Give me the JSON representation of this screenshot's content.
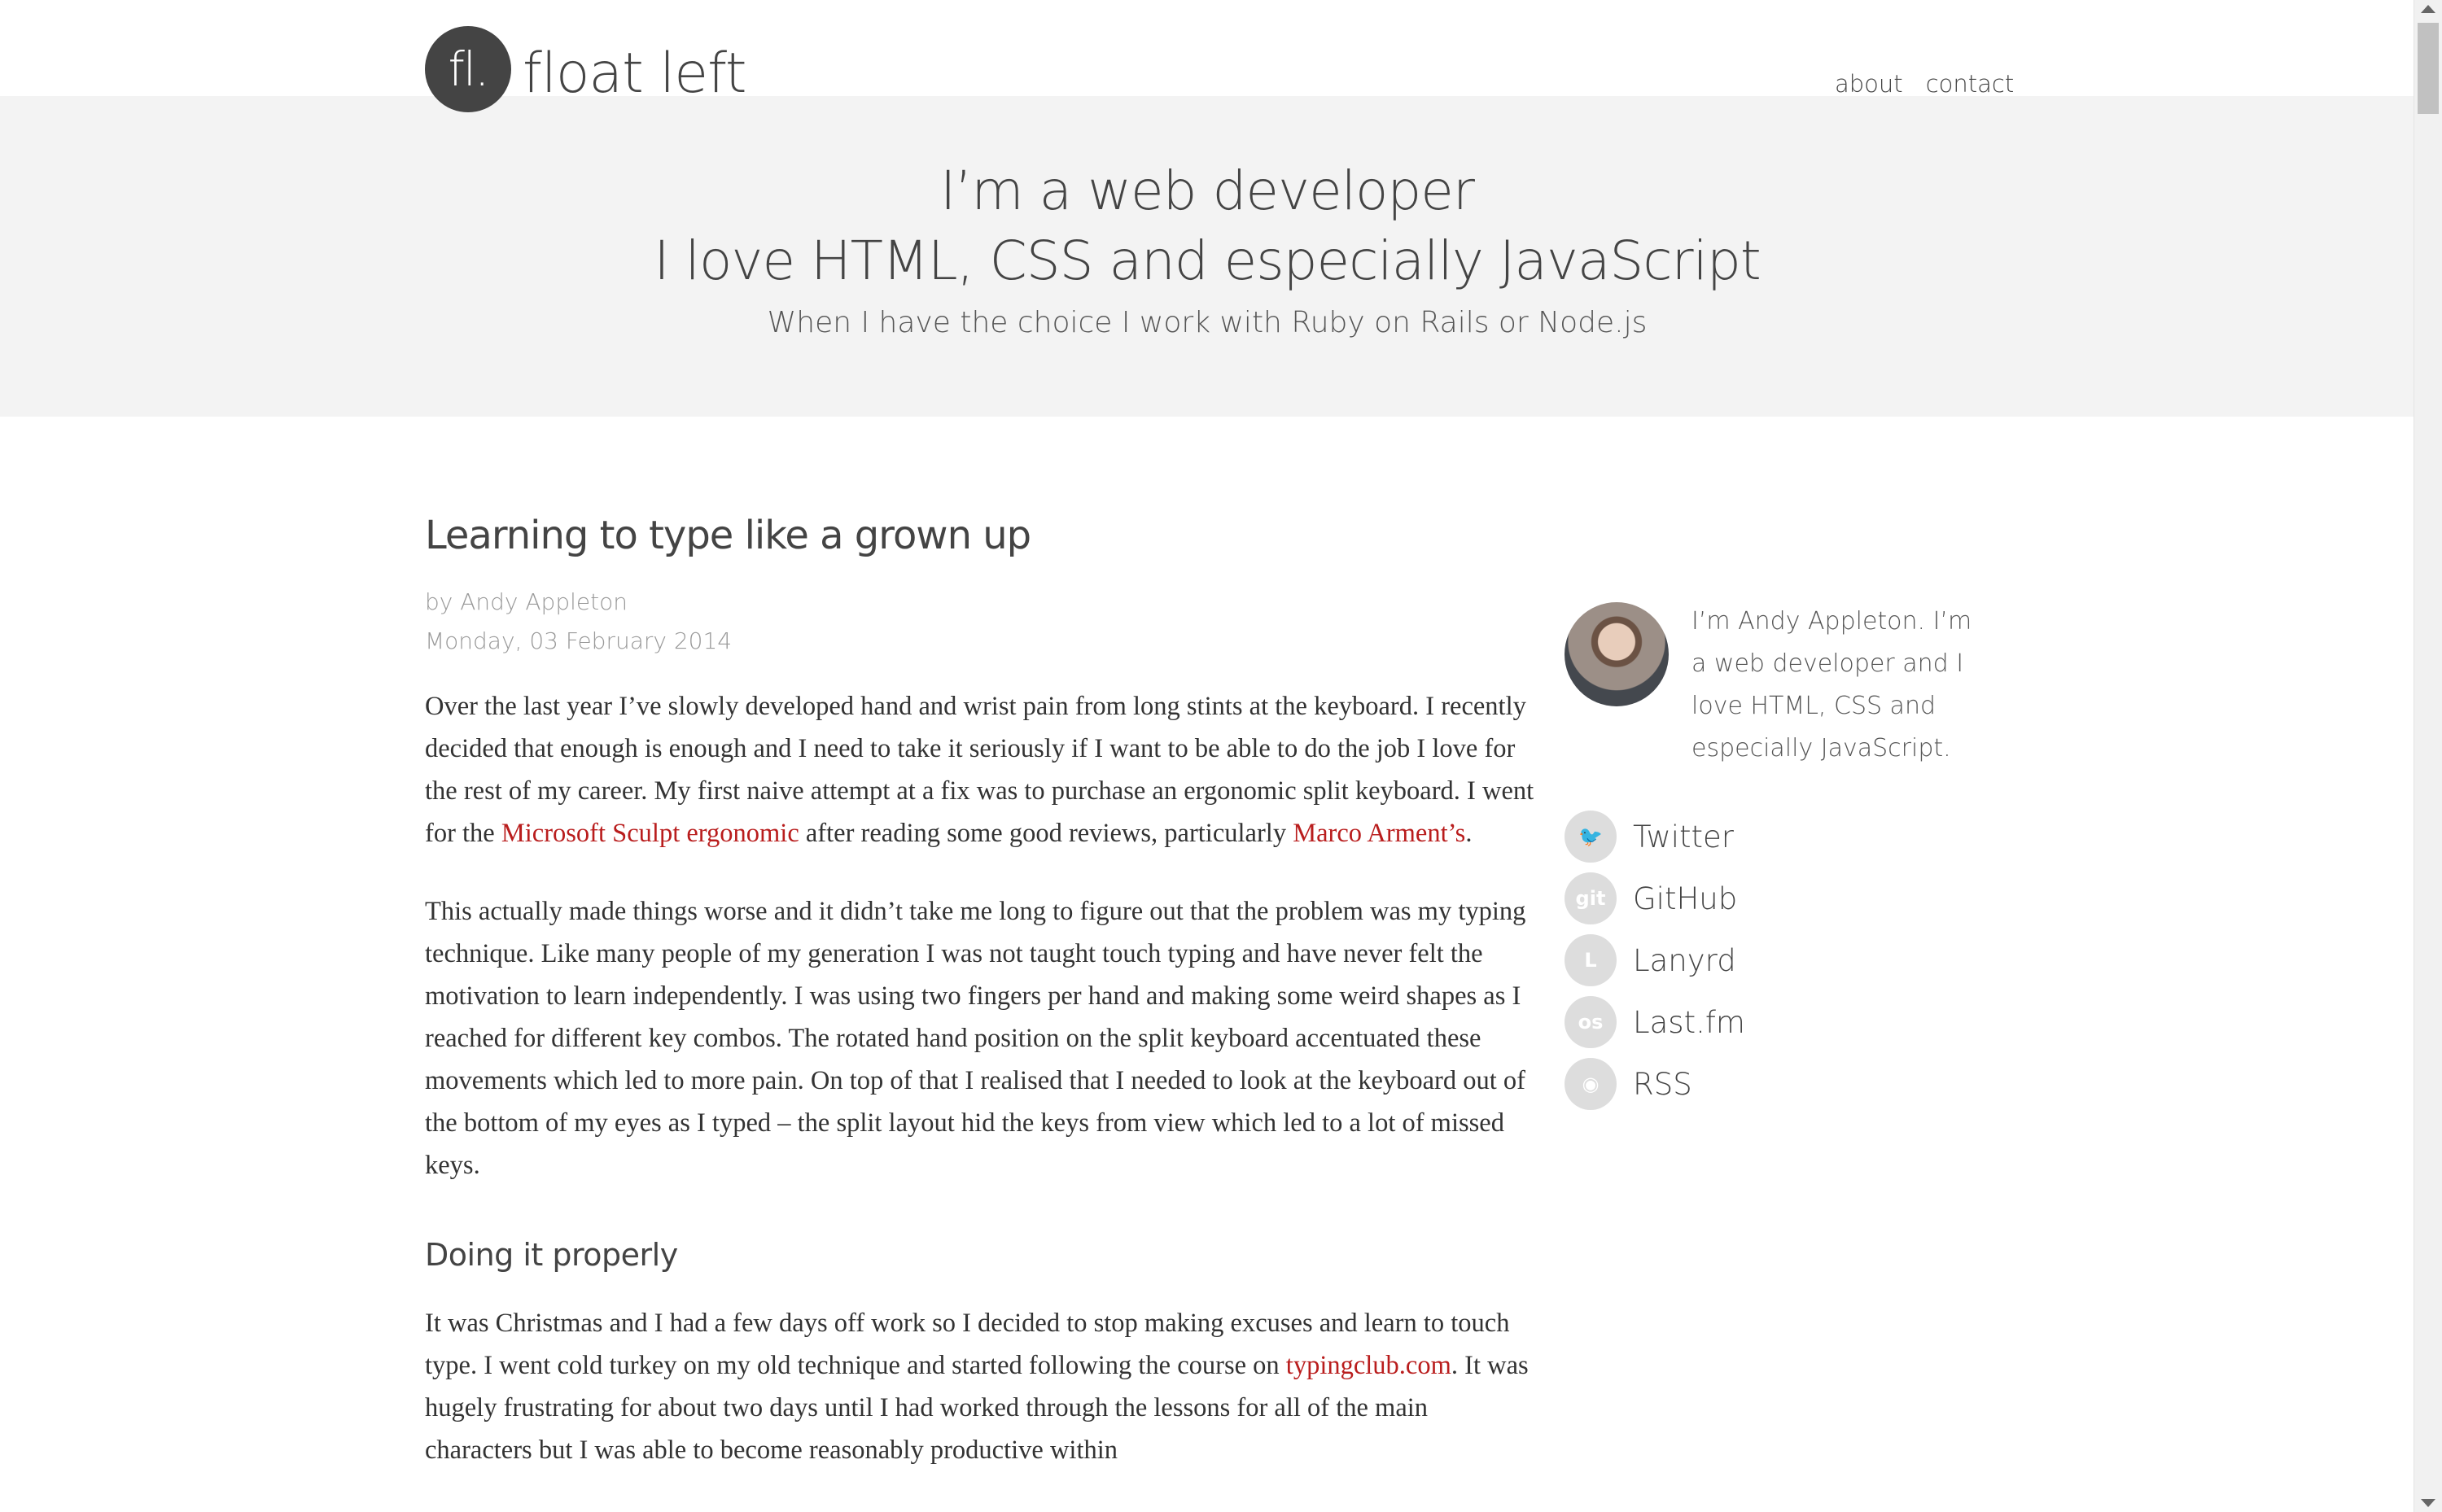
{
  "site": {
    "logo_mark": "fl.",
    "logo_text": "float left",
    "nav": [
      "about",
      "contact"
    ]
  },
  "hero": {
    "line1": "I’m a web developer",
    "line2": "I love HTML, CSS and especially JavaScript",
    "sub": "When I have the choice I work with Ruby on Rails or Node.js"
  },
  "post": {
    "title": "Learning to type like a grown up",
    "author": "by Andy Appleton",
    "date": "Monday, 03 February 2014",
    "p1_a": "Over the last year I’ve slowly developed hand and wrist pain from long stints at the keyboard. I recently decided that enough is enough and I need to take it seriously if I want to be able to do the job I love for the rest of my career. My first naive attempt at a fix was to purchase an ergonomic split keyboard. I went for the ",
    "p1_link1": "Microsoft Sculpt ergonomic",
    "p1_b": " after reading some good reviews, particularly ",
    "p1_link2": "Marco Arment’s",
    "p1_c": ".",
    "p2": "This actually made things worse and it didn’t take me long to figure out that the problem was my typing technique. Like many people of my generation I was not taught touch typing and have never felt the motivation to learn independently. I was using two fingers per hand and making some weird shapes as I reached for different key combos. The rotated hand position on the split keyboard accentuated these movements which led to more pain. On top of that I realised that I needed to look at the keyboard out of the bottom of my eyes as I typed – the split layout hid the keys from view which led to a lot of missed keys.",
    "h2": "Doing it properly",
    "p3_a": "It was Christmas and I had a few days off work so I decided to stop making excuses and learn to touch type. I went cold turkey on my old technique and started following the course on ",
    "p3_link": "typingclub.com",
    "p3_b": ". It was hugely frustrating for about two days until I had worked through the lessons for all of the main characters but I was able to become reasonably productive within"
  },
  "sidebar": {
    "bio": "I’m Andy Appleton. I’m a web developer and I love HTML, CSS and especially JavaScript.",
    "social": [
      {
        "label": "Twitter",
        "icon": "twitter-icon",
        "glyph": "🐦"
      },
      {
        "label": "GitHub",
        "icon": "github-icon",
        "glyph": "git"
      },
      {
        "label": "Lanyrd",
        "icon": "lanyrd-icon",
        "glyph": "L"
      },
      {
        "label": "Last.fm",
        "icon": "lastfm-icon",
        "glyph": "os"
      },
      {
        "label": "RSS",
        "icon": "rss-icon",
        "glyph": "◉"
      }
    ]
  },
  "colors": {
    "link": "#b91d1d",
    "hero_bg": "#f3f3f3",
    "logo_bg": "#444444",
    "social_icon_bg": "#dddddd"
  }
}
